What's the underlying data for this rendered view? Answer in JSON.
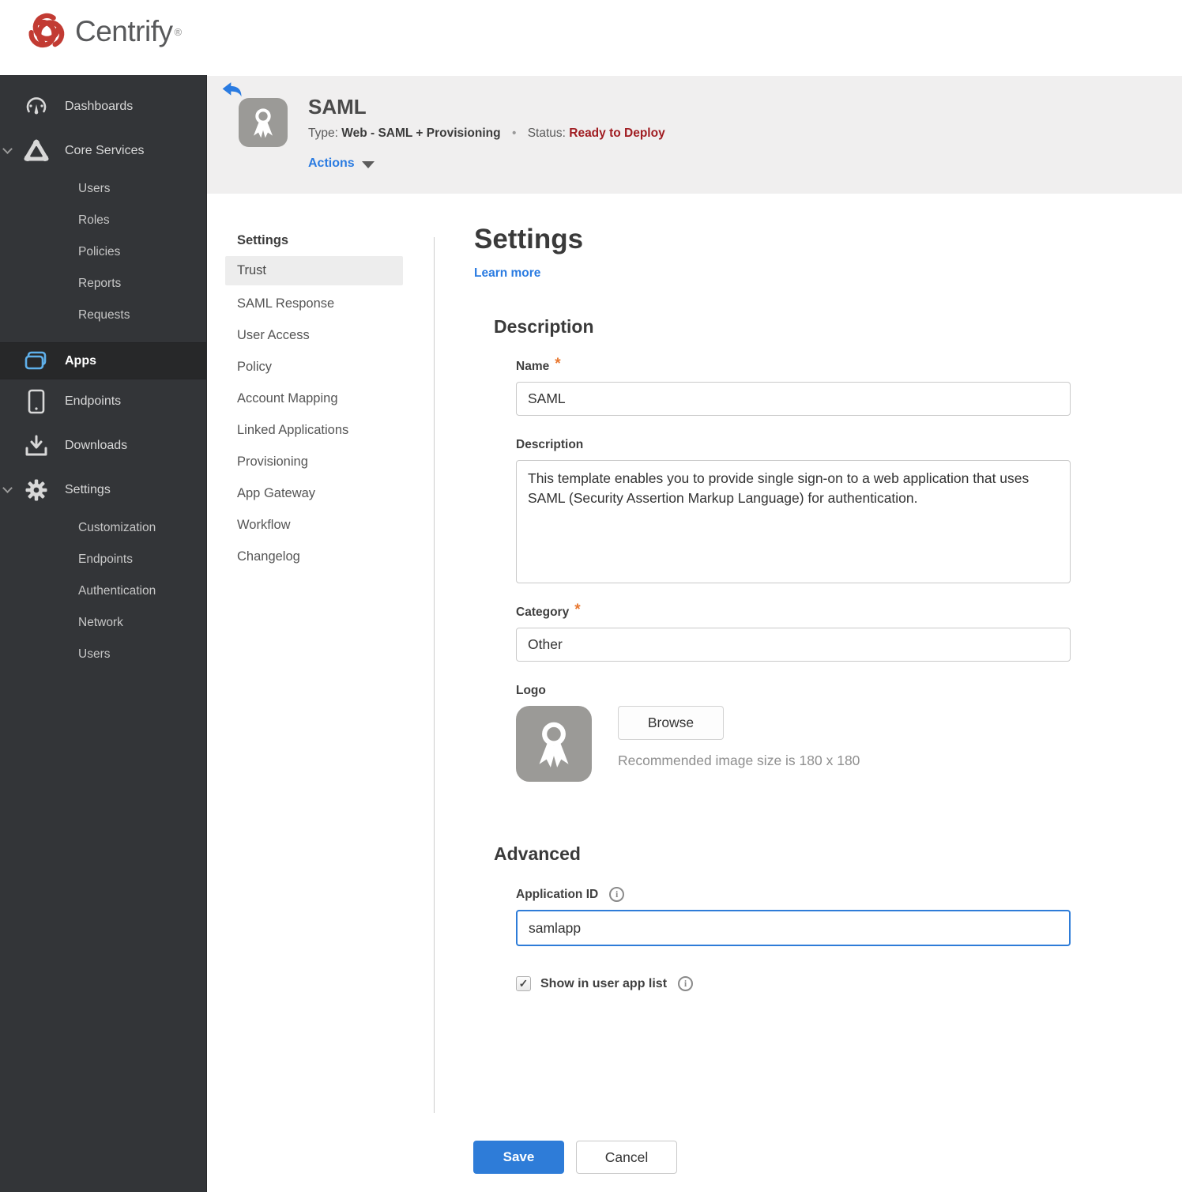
{
  "brand": {
    "name": "Centrify",
    "registered": "®"
  },
  "sidebar": {
    "items": [
      {
        "label": "Dashboards",
        "icon": "gauge-icon"
      },
      {
        "label": "Core Services",
        "icon": "core-services-icon",
        "expanded": true,
        "children": [
          "Users",
          "Roles",
          "Policies",
          "Reports",
          "Requests"
        ]
      },
      {
        "label": "Apps",
        "icon": "apps-icon",
        "selected": true
      },
      {
        "label": "Endpoints",
        "icon": "device-icon"
      },
      {
        "label": "Downloads",
        "icon": "download-icon"
      },
      {
        "label": "Settings",
        "icon": "gear-icon",
        "expanded": true,
        "children": [
          "Customization",
          "Endpoints",
          "Authentication",
          "Network",
          "Users"
        ]
      }
    ]
  },
  "header": {
    "app_name": "SAML",
    "type_label": "Type:",
    "type_value": "Web - SAML + Provisioning",
    "dot": "•",
    "status_label": "Status:",
    "status_value": "Ready to Deploy",
    "actions_label": "Actions"
  },
  "subnav": {
    "title": "Settings",
    "items": [
      {
        "label": "Trust",
        "selected": true
      },
      {
        "label": "SAML Response"
      },
      {
        "label": "User Access"
      },
      {
        "label": "Policy"
      },
      {
        "label": "Account Mapping"
      },
      {
        "label": "Linked Applications"
      },
      {
        "label": "Provisioning"
      },
      {
        "label": "App Gateway"
      },
      {
        "label": "Workflow"
      },
      {
        "label": "Changelog"
      }
    ]
  },
  "main": {
    "title": "Settings",
    "learn_more": "Learn more",
    "required_marker": "*",
    "description": {
      "heading": "Description",
      "name_label": "Name",
      "name_value": "SAML",
      "description_label": "Description",
      "description_value": "This template enables you to provide single sign-on to a web application that uses SAML (Security Assertion Markup Language) for authentication.",
      "category_label": "Category",
      "category_value": "Other",
      "logo_label": "Logo",
      "browse_label": "Browse",
      "logo_hint": "Recommended image size is 180 x 180"
    },
    "advanced": {
      "heading": "Advanced",
      "app_id_label": "Application ID",
      "app_id_value": "samlapp",
      "show_in_list_label": "Show in user app list",
      "checkbox_checked": "checked",
      "checkmark": "✓",
      "info_glyph": "i"
    },
    "footer": {
      "save_label": "Save",
      "cancel_label": "Cancel"
    }
  },
  "colors": {
    "accent_blue": "#2e7cd8",
    "link_blue": "#2a7be1",
    "status_red": "#a01d22",
    "required_orange": "#e8772f",
    "brand_red": "#c23b33",
    "sidebar_bg": "#333538",
    "header_bg": "#f0efef",
    "apps_icon_blue": "#5fb0ea"
  }
}
